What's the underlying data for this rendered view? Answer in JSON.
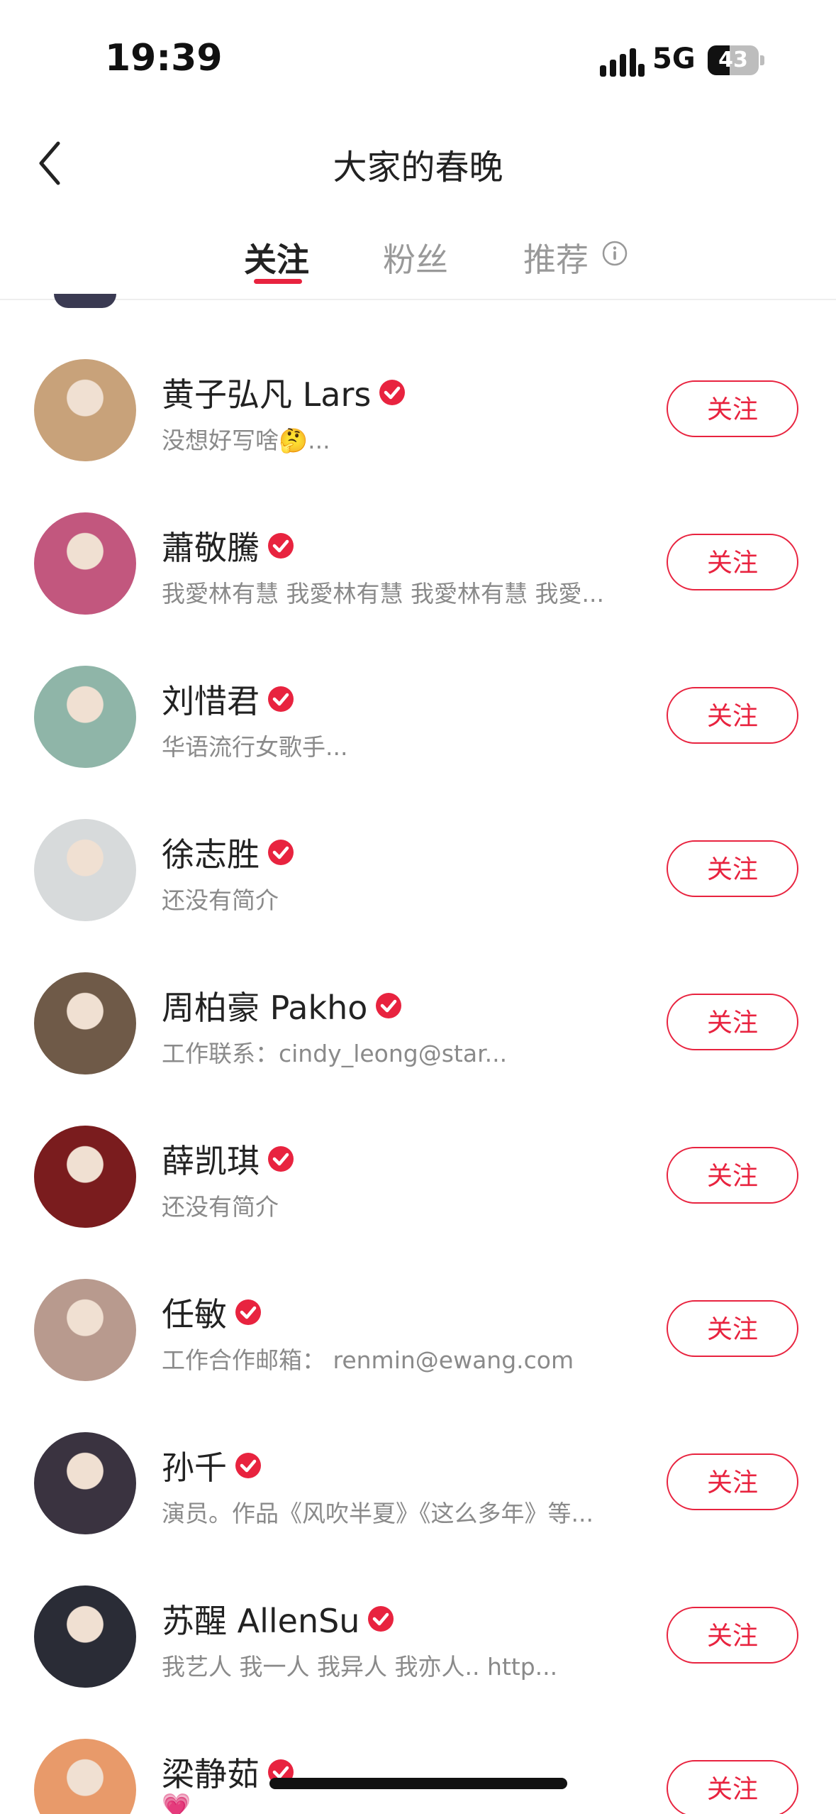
{
  "status_bar": {
    "time": "19:39",
    "network": "5G",
    "battery": "43",
    "battery_level": 0.43
  },
  "header": {
    "title": "大家的春晚",
    "back_icon": "chevron-left-icon"
  },
  "tabs": [
    {
      "label": "关注",
      "active": true
    },
    {
      "label": "粉丝",
      "active": false
    },
    {
      "label": "推荐",
      "active": false,
      "icon": "info-icon"
    }
  ],
  "accent_color": "#e8233f",
  "users": [
    {
      "name": "黄子弘凡 Lars",
      "bio": "没想好写啥🤔...",
      "button": "关注",
      "avatar_color": "#c8a27a"
    },
    {
      "name": "蕭敬騰",
      "bio": "我愛林有慧 我愛林有慧 我愛林有慧 我愛...",
      "button": "关注",
      "avatar_color": "#c2577e"
    },
    {
      "name": "刘惜君",
      "bio": "华语流行女歌手...",
      "button": "关注",
      "avatar_color": "#8fb5a8"
    },
    {
      "name": "徐志胜",
      "bio": "还没有简介",
      "button": "关注",
      "avatar_color": "#d7dadb"
    },
    {
      "name": "周柏豪 Pakho",
      "bio": "工作联系：cindy_leong@star...",
      "button": "关注",
      "avatar_color": "#6f5a48"
    },
    {
      "name": "薛凯琪",
      "bio": "还没有简介",
      "button": "关注",
      "avatar_color": "#7a1c1e"
    },
    {
      "name": "任敏",
      "bio": "工作合作邮箱： renmin@ewang.com",
      "button": "关注",
      "avatar_color": "#b89a8e"
    },
    {
      "name": "孙千",
      "bio": "演员。作品《风吹半夏》《这么多年》等...",
      "button": "关注",
      "avatar_color": "#3a3340"
    },
    {
      "name": "苏醒 AllenSu",
      "bio": "我艺人 我一人 我异人 我亦人.. http...",
      "button": "关注",
      "avatar_color": "#2a2c36"
    },
    {
      "name": "梁静茹",
      "bio": "💗",
      "button": "关注",
      "avatar_color": "#e89a6a"
    }
  ]
}
